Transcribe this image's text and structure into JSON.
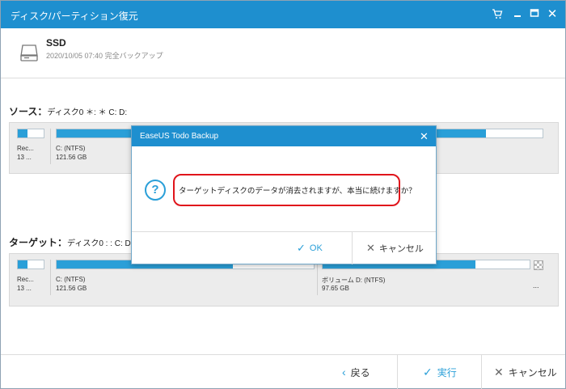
{
  "window": {
    "title": "ディスク/パーティション復元",
    "controls": [
      "cart-icon",
      "minimize-icon",
      "maximize-icon",
      "close-icon"
    ]
  },
  "header": {
    "name": "SSD",
    "subtitle": "2020/10/05 07:40 完全バックアップ",
    "icon": "drive-icon"
  },
  "source": {
    "label": "ソース：",
    "detail": "ディスク0 ＊: ＊ C: D:",
    "partitions": [
      {
        "line1": "Rec...",
        "line2": "13 ...",
        "fill": 0.35
      },
      {
        "line1": "C: (NTFS)",
        "line2": "121.56 GB",
        "fill": 0.88
      }
    ]
  },
  "target": {
    "label": "ターゲット：",
    "detail": "ディスク0 : : C: D:",
    "partitions": [
      {
        "line1": "Rec...",
        "line2": "13 ...",
        "fill": 0.35
      },
      {
        "line1": "C: (NTFS)",
        "line2": "121.56 GB",
        "fill": 0.68
      },
      {
        "line1": "ボリューム D: (NTFS)",
        "line2": "97.65 GB",
        "fill": 0.7
      }
    ],
    "more": "..."
  },
  "dialog": {
    "title": "EaseUS Todo Backup",
    "message": "ターゲットディスクのデータが消去されますが、本当に続けますか？",
    "ok_label": "OK",
    "cancel_label": "キャンセル",
    "accent": "#e0141b"
  },
  "footer": {
    "back_label": "戻る",
    "execute_label": "実行",
    "cancel_label": "キャンセル"
  },
  "colors": {
    "titlebar": "#1e8fcf",
    "bar_fill": "#2a9fd8",
    "highlight_border": "#e0141b"
  }
}
